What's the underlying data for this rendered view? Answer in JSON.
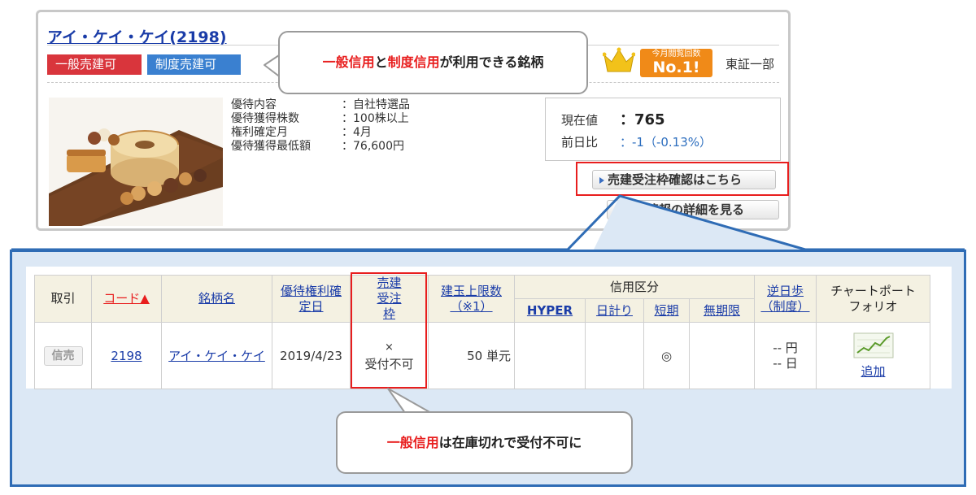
{
  "stock": {
    "title": "アイ・ケイ・ケイ(2198)",
    "badge_general": "一般売建可",
    "badge_system": "制度売建可",
    "market": "東証一部",
    "rank_top": "今月閲覧回数",
    "rank_num": "No.1!",
    "info": [
      {
        "label": "優待内容",
        "value": "：自社特選品"
      },
      {
        "label": "優待獲得株数",
        "value": "：100株以上"
      },
      {
        "label": "権利確定月",
        "value": "：4月"
      },
      {
        "label": "優待獲得最低額",
        "value": "：76,600円"
      }
    ],
    "price_label": "現在値",
    "price_value": "：765",
    "change_label": "前日比",
    "change_value": "：-1（-0.13%）",
    "btn_quota": "売建受注枠確認はこちら",
    "btn_detail": "優待情報の詳細を見る"
  },
  "callouts": {
    "top_red1": "一般信用",
    "top_mid": "と",
    "top_red2": "制度信用",
    "top_rest": "が利用できる銘柄",
    "bottom_red": "一般信用",
    "bottom_rest": "は在庫切れで受付不可に"
  },
  "table": {
    "headers": {
      "trade": "取引",
      "code": "コード▲",
      "name": "銘柄名",
      "right_date": "優待権利確定日",
      "sell_order": "売建受注枠",
      "limit": "建玉上限数（※1）",
      "credit": "信用区分",
      "hyper": "HYPER",
      "daily": "日計り",
      "short": "短期",
      "indef": "無期限",
      "gyaku": "逆日歩（制度）",
      "chart": "チャートポートフォリオ"
    },
    "row": {
      "trade_btn": "信売",
      "code": "2198",
      "name": "アイ・ケイ・ケイ",
      "date": "2019/4/23",
      "sell_x": "×",
      "sell_status": "受付不可",
      "limit": "50 単元",
      "short_mark": "◎",
      "gyaku_yen": "-- 円",
      "gyaku_day": "-- 日",
      "chart_link": "追加"
    }
  }
}
